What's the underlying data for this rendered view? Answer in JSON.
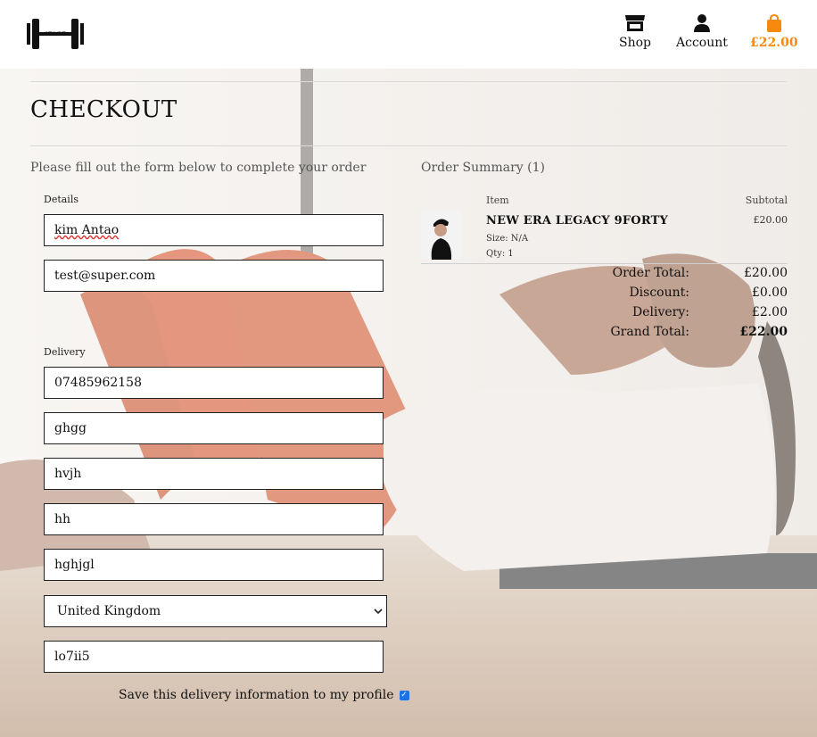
{
  "header": {
    "logo_text": "STAYFIT",
    "nav": {
      "shop_label": "Shop",
      "account_label": "Account",
      "bag_total": "£22.00"
    },
    "icons": [
      "store-icon",
      "user-icon",
      "shopping-bag-icon"
    ],
    "accent_color": "#f7890f"
  },
  "page": {
    "title": "CHECKOUT",
    "lead": "Please fill out the form below to complete your order"
  },
  "form": {
    "details_legend": "Details",
    "full_name": "kim Antao",
    "email": "test@super.com",
    "delivery_legend": "Delivery",
    "phone": "07485962158",
    "street1": "ghgg",
    "street2": "hvjh",
    "town": "hh",
    "county": "hghjgl",
    "country": "United Kingdom",
    "postcode": "lo7ii5",
    "save_label": "Save this delivery information to my profile",
    "save_checked": true
  },
  "summary": {
    "heading": "Order Summary (1)",
    "col_item": "Item",
    "col_subtotal": "Subtotal",
    "items": [
      {
        "name": "NEW ERA LEGACY 9FORTY",
        "size": "Size: N/A",
        "qty": "Qty: 1",
        "price": "£20.00"
      }
    ],
    "order_total_label": "Order Total:",
    "order_total": "£20.00",
    "discount_label": "Discount:",
    "discount": "£0.00",
    "delivery_label": "Delivery:",
    "delivery": "£2.00",
    "grand_total_label": "Grand Total:",
    "grand_total": "£22.00"
  }
}
